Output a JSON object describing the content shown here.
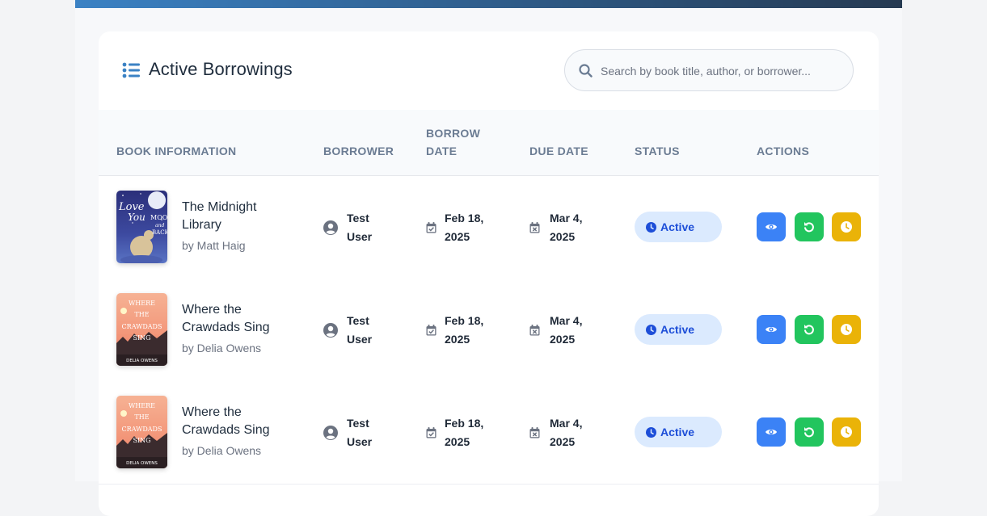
{
  "page": {
    "title": "Active Borrowings",
    "search_placeholder": "Search by book title, author, or borrower..."
  },
  "table": {
    "headers": {
      "book": "BOOK INFORMATION",
      "borrower": "BORROWER",
      "borrow_date_line1": "BORROW",
      "borrow_date_line2": "DATE",
      "due_date": "DUE DATE",
      "status": "STATUS",
      "actions": "ACTIONS"
    },
    "rows": [
      {
        "title_line1": "The Midnight",
        "title_line2": "Library",
        "author": "by Matt Haig",
        "borrower_line1": "Test",
        "borrower_line2": "User",
        "borrow_line1": "Feb 18,",
        "borrow_line2": "2025",
        "due_line1": "Mar 4,",
        "due_line2": "2025",
        "status": "Active",
        "cover": {
          "line1": "Love",
          "line2": "You",
          "line3": "MOO",
          "line4": "and",
          "line5": "BACK"
        }
      },
      {
        "title_line1": "Where the",
        "title_line2": "Crawdads Sing",
        "author": "by Delia Owens",
        "borrower_line1": "Test",
        "borrower_line2": "User",
        "borrow_line1": "Feb 18,",
        "borrow_line2": "2025",
        "due_line1": "Mar 4,",
        "due_line2": "2025",
        "status": "Active",
        "cover": {
          "line1": "WHERE",
          "line2": "THE",
          "line3": "CRAWDADS",
          "line4": "SING",
          "line5": "DELIA OWENS"
        }
      },
      {
        "title_line1": "Where the",
        "title_line2": "Crawdads Sing",
        "author": "by Delia Owens",
        "borrower_line1": "Test",
        "borrower_line2": "User",
        "borrow_line1": "Feb 18,",
        "borrow_line2": "2025",
        "due_line1": "Mar 4,",
        "due_line2": "2025",
        "status": "Active",
        "cover": {
          "line1": "WHERE",
          "line2": "THE",
          "line3": "CRAWDADS",
          "line4": "SING",
          "line5": "DELIA OWENS"
        }
      }
    ]
  },
  "icons": {
    "header": "list-icon",
    "search": "search-icon",
    "borrower": "user-circle-icon",
    "borrow_date": "calendar-check-icon",
    "due_date": "calendar-x-icon",
    "status": "clock-icon",
    "view": "eye-icon",
    "return": "undo-icon",
    "extend": "clock-icon"
  },
  "colors": {
    "accent": "#3b82f6",
    "view_button": "#3b82f6",
    "return_button": "#22c55e",
    "extend_button": "#eab308",
    "status_bg": "#dbeafe",
    "status_text": "#1d4ed8"
  }
}
